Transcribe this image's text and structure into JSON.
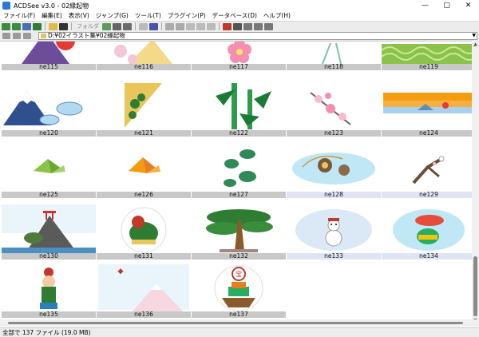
{
  "window": {
    "title": "ACDSee v3.0 - 02縁起物",
    "minimize": "—",
    "maximize": "▢",
    "close": "✕"
  },
  "menu": [
    {
      "label": "ファイル(F)"
    },
    {
      "label": "編集(E)"
    },
    {
      "label": "表示(V)"
    },
    {
      "label": "ジャンプ(G)"
    },
    {
      "label": "ツール(T)"
    },
    {
      "label": "プラグイン(P)"
    },
    {
      "label": "データベース(D)"
    },
    {
      "label": "ヘルプ(H)"
    }
  ],
  "toolbar": {
    "browse_label": "フォルダ"
  },
  "address": {
    "path": "D:¥02イラスト集¥02縁起物"
  },
  "thumbnails": [
    {
      "label": "ne115",
      "icon": "mount-fuji-sun"
    },
    {
      "label": "ne116",
      "icon": "plum-fan"
    },
    {
      "label": "ne117",
      "icon": "plum-blossom"
    },
    {
      "label": "ne118",
      "icon": "bamboo-leaves"
    },
    {
      "label": "ne119",
      "icon": "wave-pattern"
    },
    {
      "label": "ne120",
      "icon": "mount-fuji-clouds"
    },
    {
      "label": "ne121",
      "icon": "pine-fan"
    },
    {
      "label": "ne122",
      "icon": "bamboo"
    },
    {
      "label": "ne123",
      "icon": "plum-branch"
    },
    {
      "label": "ne124",
      "icon": "sunrise"
    },
    {
      "label": "ne125",
      "icon": "paper-crane-green"
    },
    {
      "label": "ne126",
      "icon": "paper-crane-orange"
    },
    {
      "label": "ne127",
      "icon": "pine-emblem"
    },
    {
      "label": "ne128",
      "icon": "spinning-top"
    },
    {
      "label": "ne129",
      "icon": "plum-tree"
    },
    {
      "label": "ne130",
      "icon": "turtle-shrine"
    },
    {
      "label": "ne131",
      "icon": "ox-figure"
    },
    {
      "label": "ne132",
      "icon": "pine-tree"
    },
    {
      "label": "ne133",
      "icon": "snowman"
    },
    {
      "label": "ne134",
      "icon": "sea-bream-lion"
    },
    {
      "label": "ne135",
      "icon": "kite-boy"
    },
    {
      "label": "ne136",
      "icon": "fuji-kite"
    },
    {
      "label": "ne137",
      "icon": "treasure-ship"
    }
  ],
  "status": {
    "text": "全部で 137 ファイル (19.0 MB)"
  },
  "colors": {
    "label_bg": "#c8c8c8",
    "label_selected_bg": "#dfe4f4",
    "toolbar_bg": "#ececec"
  }
}
